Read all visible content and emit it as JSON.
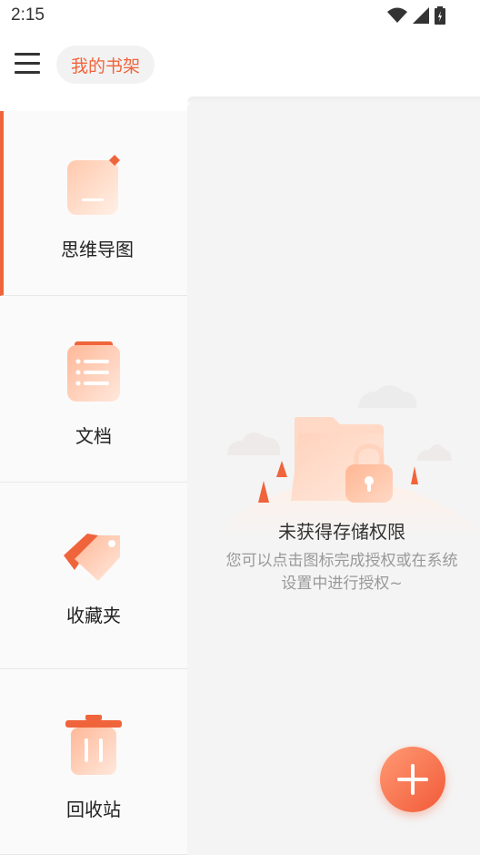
{
  "status_bar": {
    "time": "2:15"
  },
  "header": {
    "title": "我的书架"
  },
  "sidebar": {
    "items": [
      {
        "label": "思维导图",
        "icon": "mindmap-icon",
        "active": true
      },
      {
        "label": "文档",
        "icon": "document-icon",
        "active": false
      },
      {
        "label": "收藏夹",
        "icon": "tag-icon",
        "active": false
      },
      {
        "label": "回收站",
        "icon": "trash-icon",
        "active": false
      }
    ]
  },
  "empty_state": {
    "title": "未获得存储权限",
    "description_line1": "您可以点击图标完成授权或在系统",
    "description_line2": "设置中进行授权~",
    "icon": "locked-folder-icon"
  },
  "fab": {
    "icon": "plus-icon"
  },
  "colors": {
    "accent": "#f0643c",
    "panel": "#f4f4f4",
    "sidebar": "#fafafa"
  }
}
